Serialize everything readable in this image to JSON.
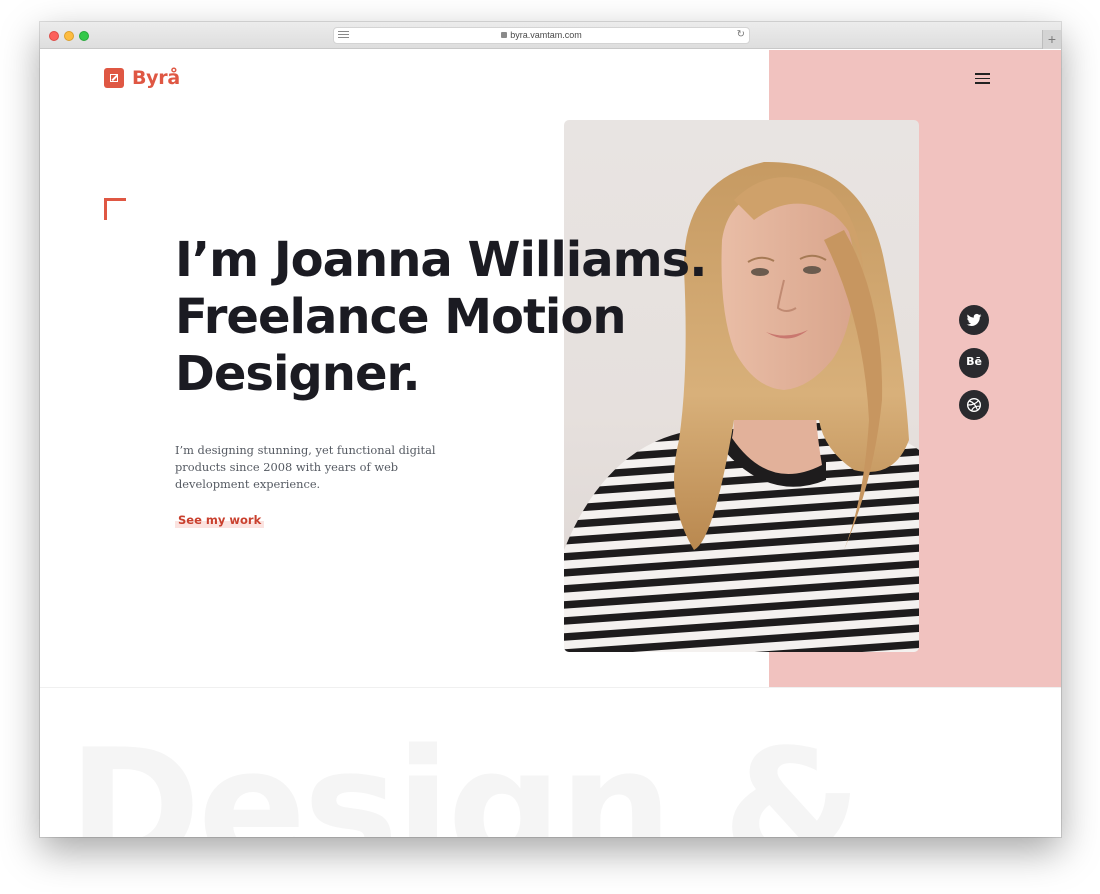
{
  "browser": {
    "url": "byra.vamtam.com"
  },
  "brand": {
    "name": "Byrå",
    "accent_color": "#df5743",
    "panel_color": "#f1c2bf"
  },
  "nav": {
    "menu_icon": "hamburger-menu-icon"
  },
  "hero": {
    "headline_lines": [
      "I’m Joanna Williams.",
      "Freelance Motion",
      "Designer."
    ],
    "intro": "I’m designing stunning, yet functional digital products since 2008 with years of web development experience.",
    "cta_label": "See my work",
    "photo_icon": "portrait-photo"
  },
  "social": {
    "twitter_icon": "twitter-icon",
    "behance_label": "Bē",
    "dribbble_icon": "dribbble-icon"
  },
  "section": {
    "background_word": "Design &"
  }
}
